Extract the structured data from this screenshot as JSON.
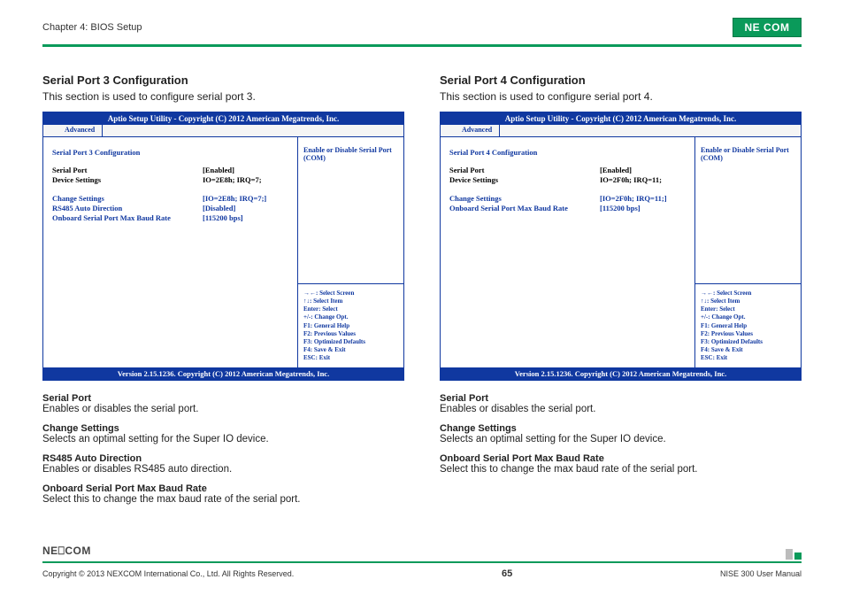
{
  "header": {
    "chapter": "Chapter 4: BIOS Setup",
    "logo_text": "NE COM"
  },
  "left": {
    "title": "Serial Port 3 Configuration",
    "intro": "This section is used to configure serial port 3.",
    "bios": {
      "header": "Aptio Setup Utility - Copyright (C) 2012 American Megatrends, Inc.",
      "tab": "Advanced",
      "section_title": "Serial Port 3 Configuration",
      "rows_top": [
        {
          "label": "Serial Port",
          "value": "[Enabled]",
          "cls": "black"
        },
        {
          "label": "Device Settings",
          "value": "IO=2E8h; IRQ=7;",
          "cls": "black"
        }
      ],
      "rows_mid": [
        {
          "label": "Change Settings",
          "value": "[IO=2E8h; IRQ=7;]",
          "cls": "blue"
        },
        {
          "label": "RS485 Auto Direction",
          "value": "[Disabled]",
          "cls": "blue"
        },
        {
          "label": "Onboard Serial Port Max Baud Rate",
          "value": "[115200 bps]",
          "cls": "blue"
        }
      ],
      "help_top": "Enable or Disable Serial Port (COM)",
      "help_lines": [
        "→←: Select Screen",
        "↑↓: Select Item",
        "Enter: Select",
        "+/-: Change Opt.",
        "F1: General Help",
        "F2: Previous Values",
        "F3: Optimized Defaults",
        "F4: Save & Exit",
        "ESC: Exit"
      ],
      "footer": "Version 2.15.1236. Copyright (C) 2012 American Megatrends, Inc."
    },
    "descs": [
      {
        "title": "Serial Port",
        "text": "Enables or disables the serial port."
      },
      {
        "title": "Change Settings",
        "text": "Selects an optimal setting for the Super IO device."
      },
      {
        "title": "RS485 Auto Direction",
        "text": "Enables or disables RS485 auto direction."
      },
      {
        "title": "Onboard Serial Port Max Baud Rate",
        "text": "Select this to change the max baud rate of the serial port."
      }
    ]
  },
  "right": {
    "title": "Serial Port 4 Configuration",
    "intro": "This section is used to configure serial port 4.",
    "bios": {
      "header": "Aptio Setup Utility - Copyright (C) 2012 American Megatrends, Inc.",
      "tab": "Advanced",
      "section_title": "Serial Port 4 Configuration",
      "rows_top": [
        {
          "label": "Serial Port",
          "value": "[Enabled]",
          "cls": "black"
        },
        {
          "label": "Device Settings",
          "value": "IO=2F0h; IRQ=11;",
          "cls": "black"
        }
      ],
      "rows_mid": [
        {
          "label": "Change Settings",
          "value": "[IO=2F0h; IRQ=11;]",
          "cls": "blue"
        },
        {
          "label": "Onboard Serial Port Max Baud Rate",
          "value": "[115200 bps]",
          "cls": "blue"
        }
      ],
      "help_top": "Enable or Disable Serial Port (COM)",
      "help_lines": [
        "→←: Select Screen",
        "↑↓: Select Item",
        "Enter: Select",
        "+/-: Change Opt.",
        "F1: General Help",
        "F2: Previous Values",
        "F3: Optimized Defaults",
        "F4: Save & Exit",
        "ESC: Exit"
      ],
      "footer": "Version 2.15.1236. Copyright (C) 2012 American Megatrends, Inc."
    },
    "descs": [
      {
        "title": "Serial Port",
        "text": "Enables or disables the serial port."
      },
      {
        "title": "Change Settings",
        "text": "Selects an optimal setting for the Super IO device."
      },
      {
        "title": "Onboard Serial Port Max Baud Rate",
        "text": "Select this to change the max baud rate of the serial port."
      }
    ]
  },
  "footer": {
    "logo_text": "NE⎕COM",
    "copyright": "Copyright © 2013 NEXCOM International Co., Ltd. All Rights Reserved.",
    "page": "65",
    "doc": "NISE 300 User Manual"
  }
}
